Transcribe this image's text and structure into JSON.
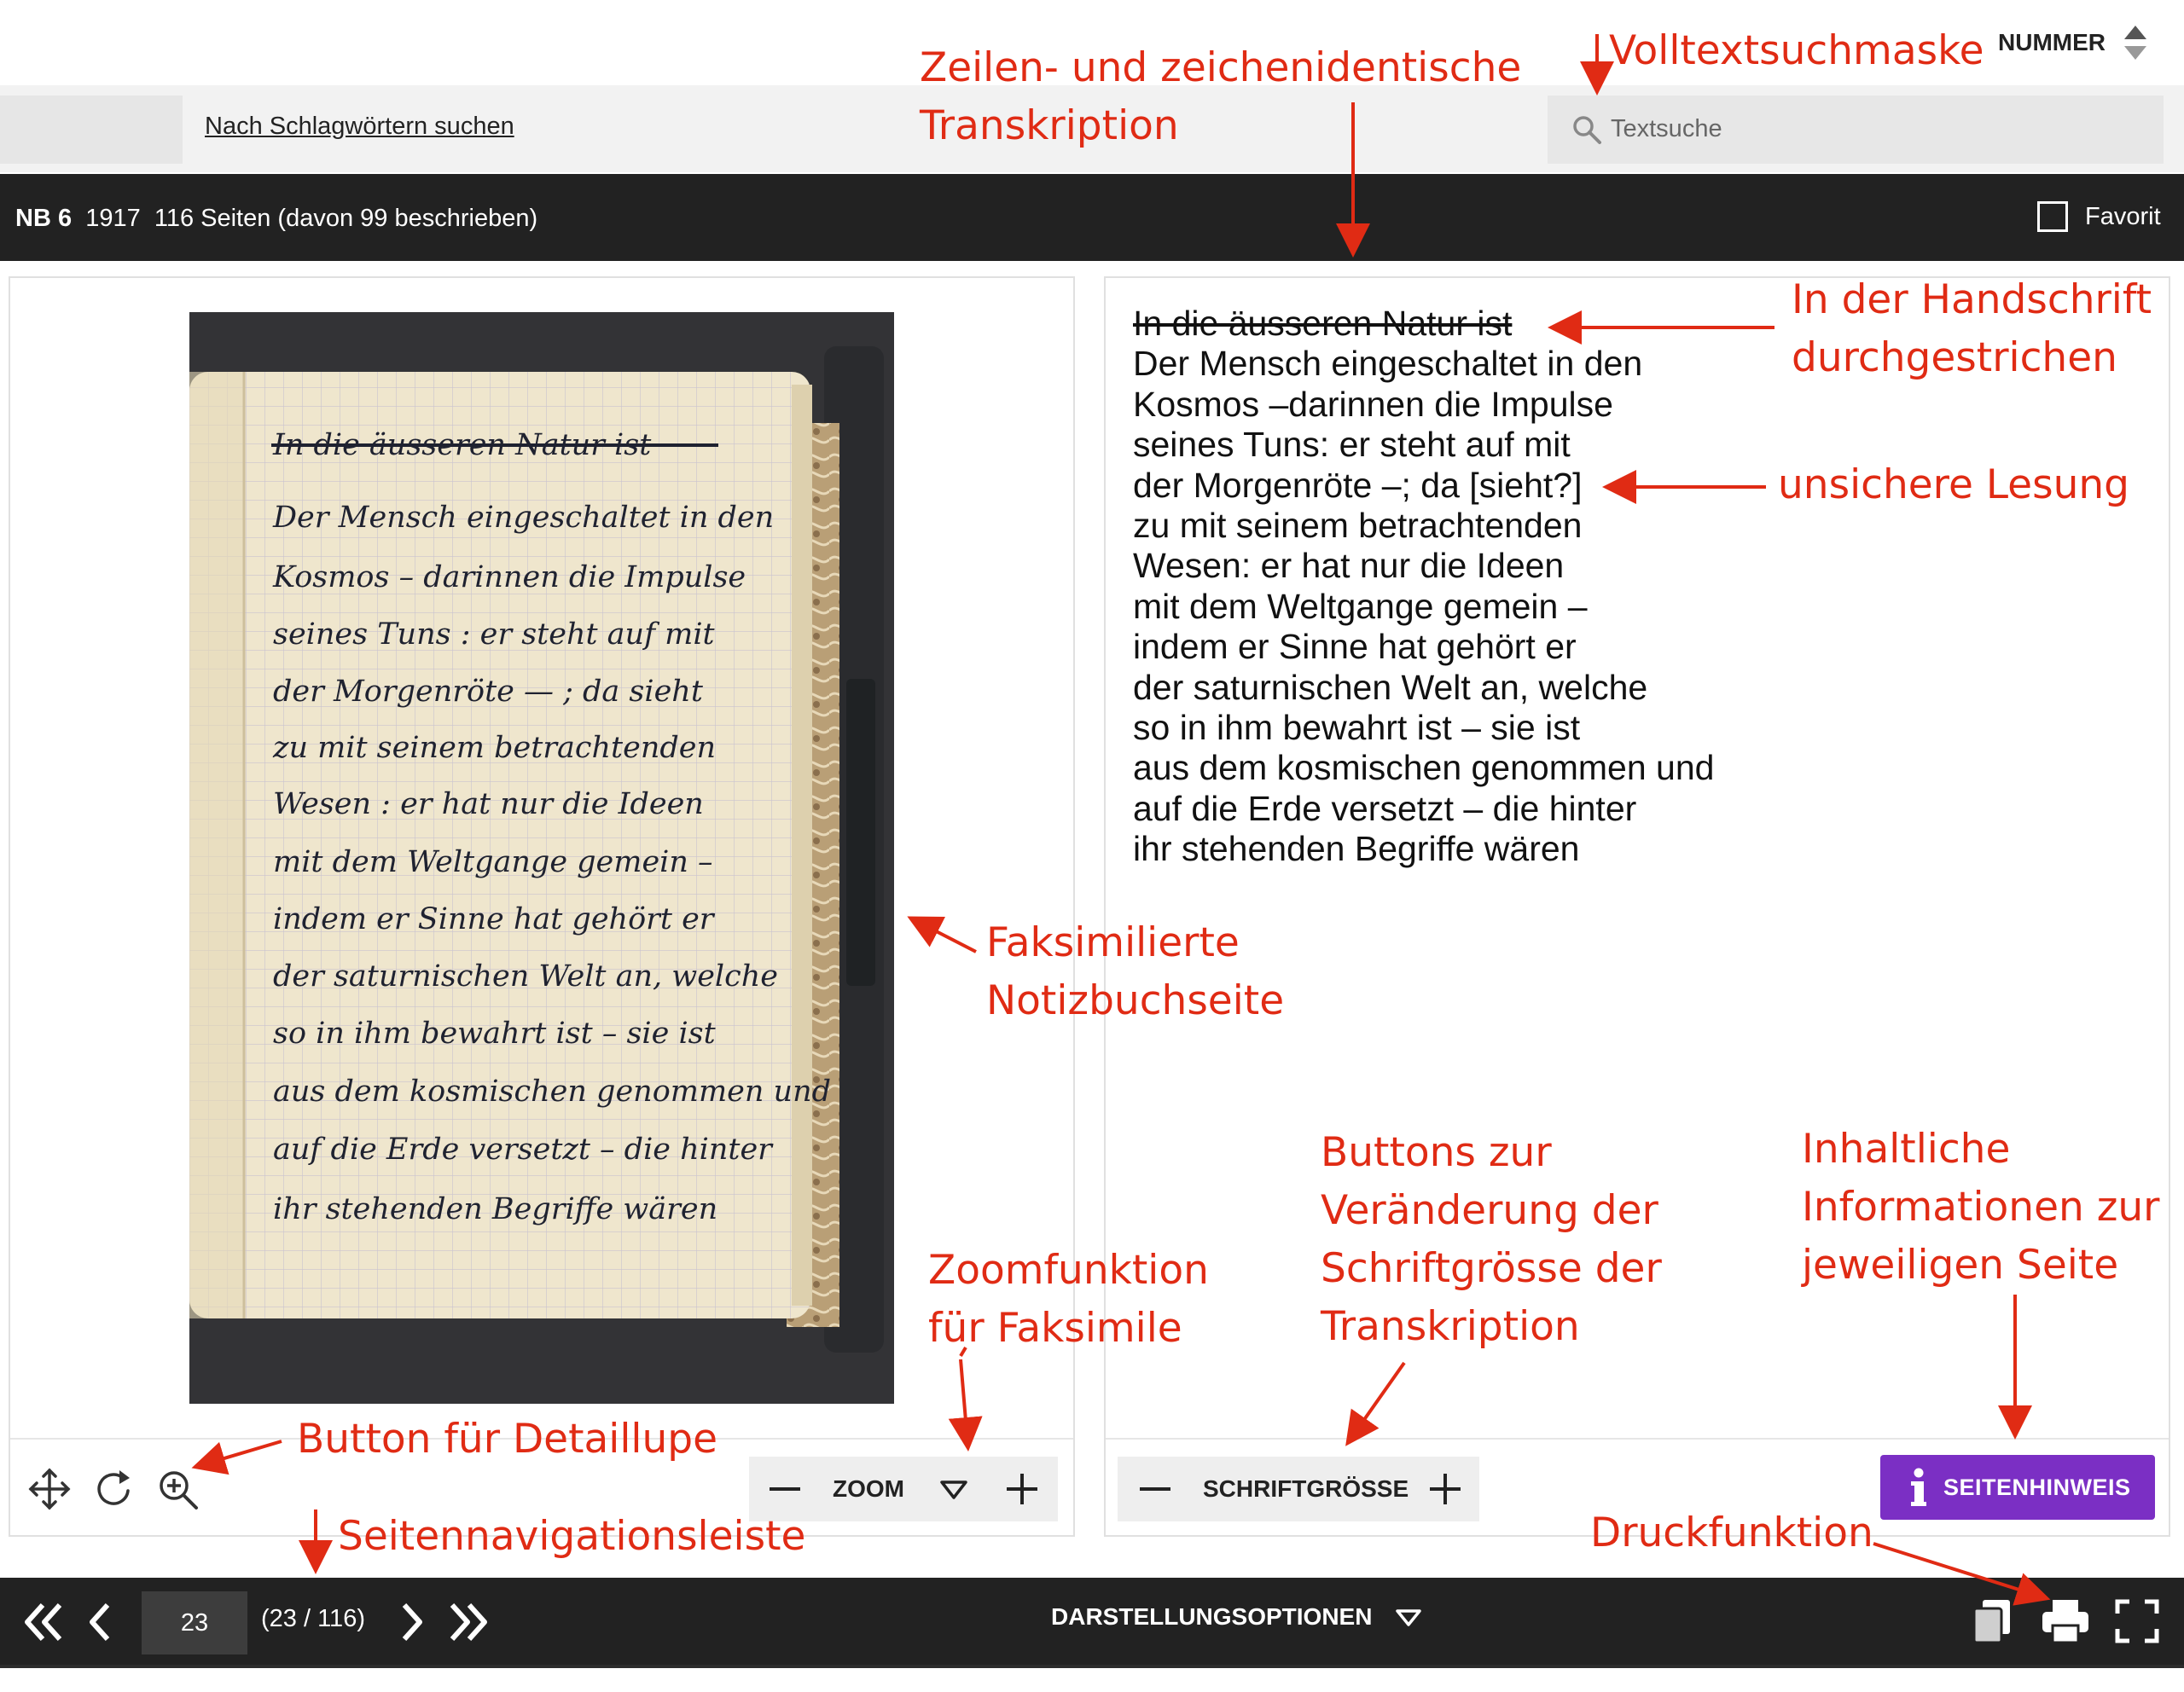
{
  "toolbar": {
    "keyword_search_link": "Nach Schlagwörtern suchen",
    "search_placeholder": "Textsuche",
    "sort_label": "NUMMER"
  },
  "notebook_info": {
    "id": "NB 6",
    "year": "1917",
    "pages": "116 Seiten (davon 99 beschrieben)",
    "favorite_label": "Favorit"
  },
  "transcription": {
    "lines": [
      "In die äusseren Natur ist",
      "Der Mensch eingeschaltet in den",
      "Kosmos –darinnen die Impulse",
      "seines Tuns: er steht auf mit",
      "der Morgenröte –; da [sieht?]",
      "zu mit seinem betrachtenden",
      "Wesen: er hat nur die Ideen",
      "mit dem Weltgange gemein –",
      "indem er Sinne hat gehört er",
      "der saturnischen Welt an, welche",
      "so in ihm bewahrt ist – sie ist",
      "aus dem kosmischen genommen und",
      "auf die Erde versetzt – die hinter",
      "ihr stehenden Begriffe wären"
    ],
    "struck_line_index": 0
  },
  "facsimile": {
    "handwritten_lines": [
      "In die äusseren Natur ist",
      "Der Mensch eingeschaltet in den",
      "Kosmos – darinnen die Impulse",
      "seines Tuns : er steht auf mit",
      "der Morgenröte — ; da sieht",
      "zu mit seinem betrachtenden",
      "Wesen : er hat nur die Ideen",
      "mit dem Weltgange gemein –",
      "indem er Sinne hat gehört er",
      "der saturnischen Welt an, welche",
      "so in ihm bewahrt ist – sie ist",
      "aus dem kosmischen genommen und",
      "auf die Erde versetzt – die hinter",
      "ihr stehenden Begriffe wären"
    ]
  },
  "controls": {
    "zoom_label": "ZOOM",
    "font_size_label": "SCHRIFTGRÖSSE",
    "page_note_button": "SEITENHINWEIS",
    "display_options": "DARSTELLUNGSOPTIONEN"
  },
  "navigation": {
    "current_page": "23",
    "page_count": "(23 / 116)"
  },
  "annotations": {
    "volltext": "Volltextsuchmaske",
    "transkription_line1": "Zeilen- und zeichenidentische",
    "transkription_line2": "Transkription",
    "durchgestrichen_line1": "In der Handschrift",
    "durchgestrichen_line2": "durchgestrichen",
    "unsicher": "unsichere Lesung",
    "faksimile_line1": "Faksimilierte",
    "faksimile_line2": "Notizbuchseite",
    "zoom_line1": "Zoomfunktion",
    "zoom_line2": "für Faksimile",
    "schrift_line1": "Buttons zur",
    "schrift_line2": "Veränderung der",
    "schrift_line3": "Schriftgrösse der",
    "schrift_line4": "Transkription",
    "inhalt_line1": "Inhaltliche",
    "inhalt_line2": "Informationen zur",
    "inhalt_line3": "jeweiligen Seite",
    "lupe": "Button für Detaillupe",
    "navleiste": "Seitennavigationsleiste",
    "druck": "Druckfunktion"
  },
  "colors": {
    "annotation": "#e02b14",
    "dark_bar": "#222222",
    "accent_purple": "#7b2fc4"
  }
}
